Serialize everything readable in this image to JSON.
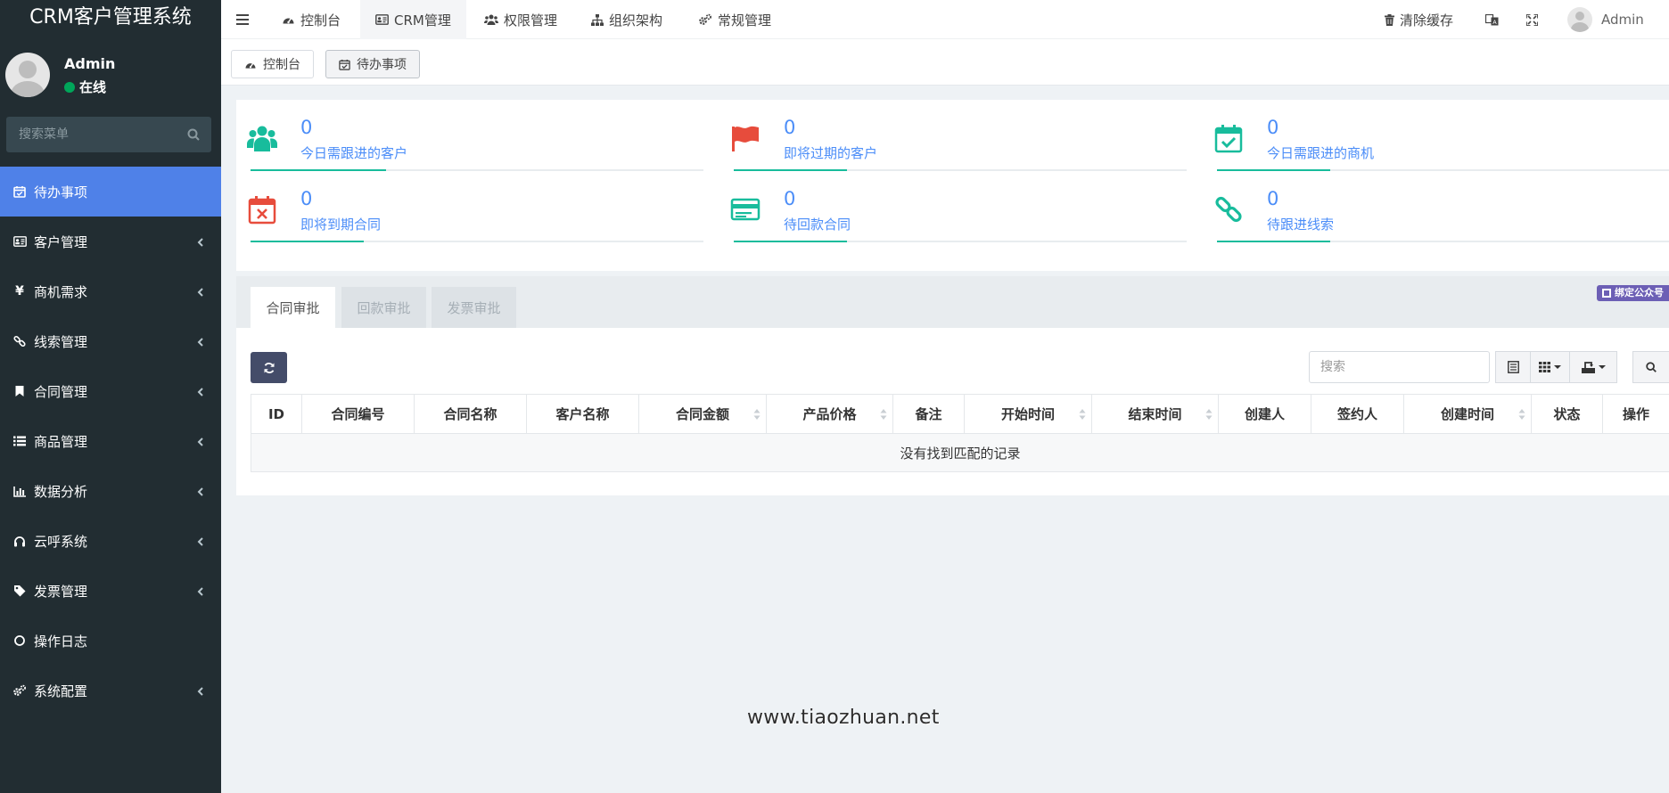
{
  "app": {
    "title": "CRM客户管理系统"
  },
  "user": {
    "name": "Admin",
    "status": "在线"
  },
  "sidebar": {
    "search_placeholder": "搜索菜单",
    "items": [
      {
        "label": "待办事项",
        "icon": "calendar-check-icon",
        "active": true,
        "has_children": false
      },
      {
        "label": "客户管理",
        "icon": "id-card-icon",
        "active": false,
        "has_children": true
      },
      {
        "label": "商机需求",
        "icon": "yen-icon",
        "active": false,
        "has_children": true
      },
      {
        "label": "线索管理",
        "icon": "link-icon",
        "active": false,
        "has_children": true
      },
      {
        "label": "合同管理",
        "icon": "bookmark-icon",
        "active": false,
        "has_children": true
      },
      {
        "label": "商品管理",
        "icon": "list-icon",
        "active": false,
        "has_children": true
      },
      {
        "label": "数据分析",
        "icon": "bar-chart-icon",
        "active": false,
        "has_children": true
      },
      {
        "label": "云呼系统",
        "icon": "headset-icon",
        "active": false,
        "has_children": true
      },
      {
        "label": "发票管理",
        "icon": "tags-icon",
        "active": false,
        "has_children": true
      },
      {
        "label": "操作日志",
        "icon": "circle-icon",
        "active": false,
        "has_children": false
      },
      {
        "label": "系统配置",
        "icon": "cogs-icon",
        "active": false,
        "has_children": true
      }
    ]
  },
  "topnav": {
    "items": [
      {
        "label": "控制台",
        "icon": "dashboard-icon"
      },
      {
        "label": "CRM管理",
        "icon": "id-card-icon",
        "active": true
      },
      {
        "label": "权限管理",
        "icon": "users-icon"
      },
      {
        "label": "组织架构",
        "icon": "sitemap-icon"
      },
      {
        "label": "常规管理",
        "icon": "cogs-icon"
      }
    ],
    "clear_cache": "清除缓存",
    "user_name": "Admin"
  },
  "page_tabs": [
    {
      "label": "控制台",
      "icon": "dashboard-icon"
    },
    {
      "label": "待办事项",
      "icon": "calendar-check-icon",
      "active": true
    }
  ],
  "stats": [
    {
      "value": "0",
      "label": "今日需跟进的客户",
      "icon": "users-icon",
      "color": "#18bc9c",
      "progress": 0.3
    },
    {
      "value": "0",
      "label": "即将过期的客户",
      "icon": "flag-icon",
      "color": "#e74c3c",
      "progress": 0.25
    },
    {
      "value": "0",
      "label": "今日需跟进的商机",
      "icon": "calendar-check-icon",
      "color": "#18bc9c",
      "progress": 0.25
    },
    {
      "value": "0",
      "label": "即将到期合同",
      "icon": "calendar-times-icon",
      "color": "#e74c3c",
      "progress": 0.25
    },
    {
      "value": "0",
      "label": "待回款合同",
      "icon": "credit-card-icon",
      "color": "#18bc9c",
      "progress": 0.25
    },
    {
      "value": "0",
      "label": "待跟进线索",
      "icon": "link-icon",
      "color": "#18bc9c",
      "progress": 0.25
    }
  ],
  "approval_tabs": [
    {
      "label": "合同审批",
      "active": true
    },
    {
      "label": "回款审批",
      "active": false
    },
    {
      "label": "发票审批",
      "active": false
    }
  ],
  "wechat_badge": "绑定公众号",
  "table": {
    "search_placeholder": "搜索",
    "columns": [
      "ID",
      "合同编号",
      "合同名称",
      "客户名称",
      "合同金额",
      "产品价格",
      "备注",
      "开始时间",
      "结束时间",
      "创建人",
      "签约人",
      "创建时间",
      "状态",
      "操作"
    ],
    "empty_text": "没有找到匹配的记录"
  },
  "watermark": "www.tiaozhuan.net",
  "colors": {
    "sidebar": "#222d32",
    "accent": "#4f81e8",
    "green": "#18bc9c",
    "red": "#e74c3c",
    "link": "#4b8df8"
  }
}
